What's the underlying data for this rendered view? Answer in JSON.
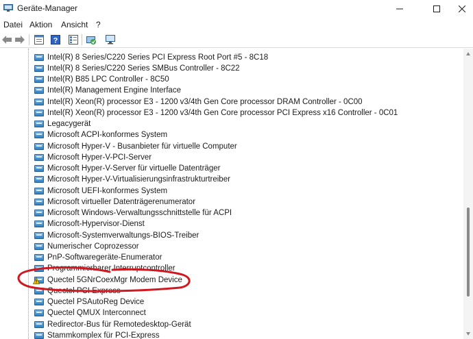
{
  "window": {
    "title": "Geräte-Manager",
    "minimize_icon": "minimize-icon",
    "maximize_icon": "maximize-icon",
    "close_icon": "close-icon"
  },
  "menu": {
    "items": [
      "Datei",
      "Aktion",
      "Ansicht",
      "?"
    ]
  },
  "toolbar": {
    "buttons": [
      "back-arrow-icon",
      "forward-arrow-icon",
      "properties-icon",
      "help-icon",
      "update-driver-icon",
      "scan-hardware-icon"
    ]
  },
  "tree": {
    "items": [
      {
        "label": "Intel(R) 8 Series/C220 Series PCI Express Root Port #5 - 8C18",
        "icon": "system-device-icon"
      },
      {
        "label": "Intel(R) 8 Series/C220 Series SMBus Controller - 8C22",
        "icon": "system-device-icon"
      },
      {
        "label": "Intel(R) B85 LPC Controller - 8C50",
        "icon": "system-device-icon"
      },
      {
        "label": "Intel(R) Management Engine Interface",
        "icon": "system-device-icon"
      },
      {
        "label": "Intel(R) Xeon(R) processor E3 - 1200 v3/4th Gen Core processor DRAM Controller - 0C00",
        "icon": "system-device-icon"
      },
      {
        "label": "Intel(R) Xeon(R) processor E3 - 1200 v3/4th Gen Core processor PCI Express x16 Controller - 0C01",
        "icon": "system-device-icon"
      },
      {
        "label": "Legacygerät",
        "icon": "system-device-icon"
      },
      {
        "label": "Microsoft ACPI-konformes System",
        "icon": "system-device-icon"
      },
      {
        "label": "Microsoft Hyper-V - Busanbieter für virtuelle Computer",
        "icon": "system-device-icon"
      },
      {
        "label": "Microsoft Hyper-V-PCI-Server",
        "icon": "system-device-icon"
      },
      {
        "label": "Microsoft Hyper-V-Server für virtuelle Datenträger",
        "icon": "system-device-icon"
      },
      {
        "label": "Microsoft Hyper-V-Virtualisierungsinfrastrukturtreiber",
        "icon": "system-device-icon"
      },
      {
        "label": "Microsoft UEFI-konformes System",
        "icon": "system-device-icon"
      },
      {
        "label": "Microsoft virtueller Datenträgerenumerator",
        "icon": "system-device-icon"
      },
      {
        "label": "Microsoft Windows-Verwaltungsschnittstelle für ACPI",
        "icon": "system-device-icon"
      },
      {
        "label": "Microsoft-Hypervisor-Dienst",
        "icon": "system-device-icon"
      },
      {
        "label": "Microsoft-Systemverwaltungs-BIOS-Treiber",
        "icon": "system-device-icon"
      },
      {
        "label": "Numerischer Coprozessor",
        "icon": "system-device-icon"
      },
      {
        "label": "PnP-Softwaregeräte-Enumerator",
        "icon": "system-device-icon"
      },
      {
        "label": "Programmierbarer Interruptcontroller",
        "icon": "system-device-icon"
      },
      {
        "label": "Quectel 5GNrCoexMgr Modem Device",
        "icon": "warning-device-icon"
      },
      {
        "label": "Quectel PCI Express",
        "icon": "system-device-icon"
      },
      {
        "label": "Quectel PSAutoReg Device",
        "icon": "system-device-icon"
      },
      {
        "label": "Quectel QMUX Interconnect",
        "icon": "system-device-icon"
      },
      {
        "label": "Redirector-Bus für Remotedesktop-Gerät",
        "icon": "system-device-icon"
      },
      {
        "label": "Stammkomplex für PCI-Express",
        "icon": "system-device-icon"
      }
    ]
  },
  "colors": {
    "annotation": "#d01820",
    "device_icon": "#2f7fc1",
    "warning": "#f2c200"
  }
}
